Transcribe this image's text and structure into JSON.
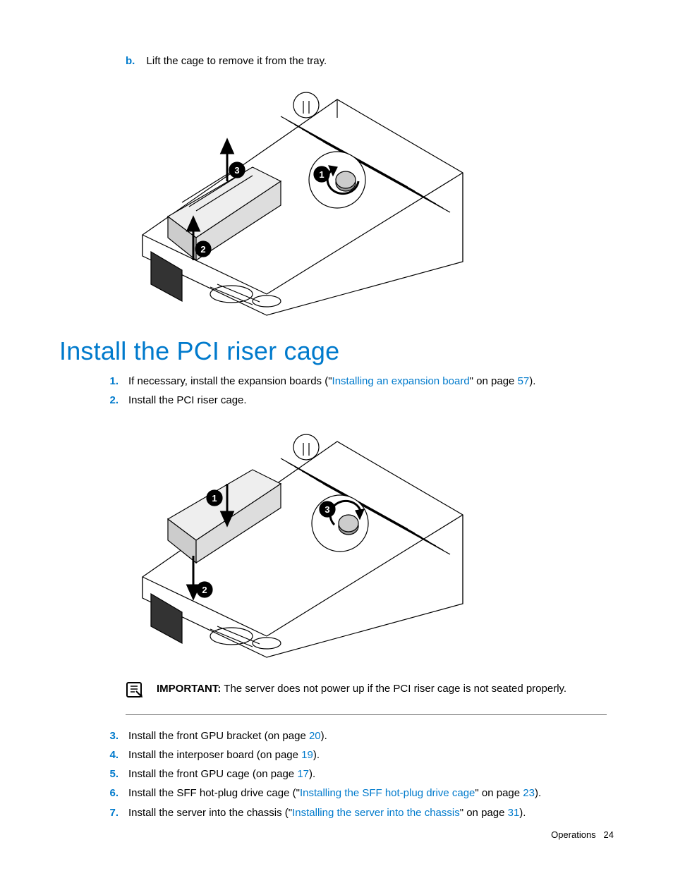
{
  "substep": {
    "letter": "b.",
    "text": "Lift the cage to remove it from the tray."
  },
  "heading": "Install the PCI riser cage",
  "steps": {
    "s1": {
      "num": "1.",
      "before": "If necessary, install the expansion boards (\"",
      "link": "Installing an expansion board",
      "after": "\" on page ",
      "page": "57",
      "close": ")."
    },
    "s2": {
      "num": "2.",
      "text": "Install the PCI riser cage."
    },
    "s3": {
      "num": "3.",
      "before": "Install the front GPU bracket (on page ",
      "page": "20",
      "close": ")."
    },
    "s4": {
      "num": "4.",
      "before": "Install the interposer board (on page ",
      "page": "19",
      "close": ")."
    },
    "s5": {
      "num": "5.",
      "before": "Install the front GPU cage (on page ",
      "page": "17",
      "close": ")."
    },
    "s6": {
      "num": "6.",
      "before": "Install the SFF hot-plug drive cage (\"",
      "link": "Installing the SFF hot-plug drive cage",
      "after": "\" on page ",
      "page": "23",
      "close": ")."
    },
    "s7": {
      "num": "7.",
      "before": "Install the server into the chassis (\"",
      "link": "Installing the server into the chassis",
      "after": "\" on page ",
      "page": "31",
      "close": ")."
    }
  },
  "important": {
    "label": "IMPORTANT:",
    "text": "  The server does not power up if the PCI riser cage is not seated properly."
  },
  "footer": {
    "section": "Operations",
    "page": "24"
  }
}
